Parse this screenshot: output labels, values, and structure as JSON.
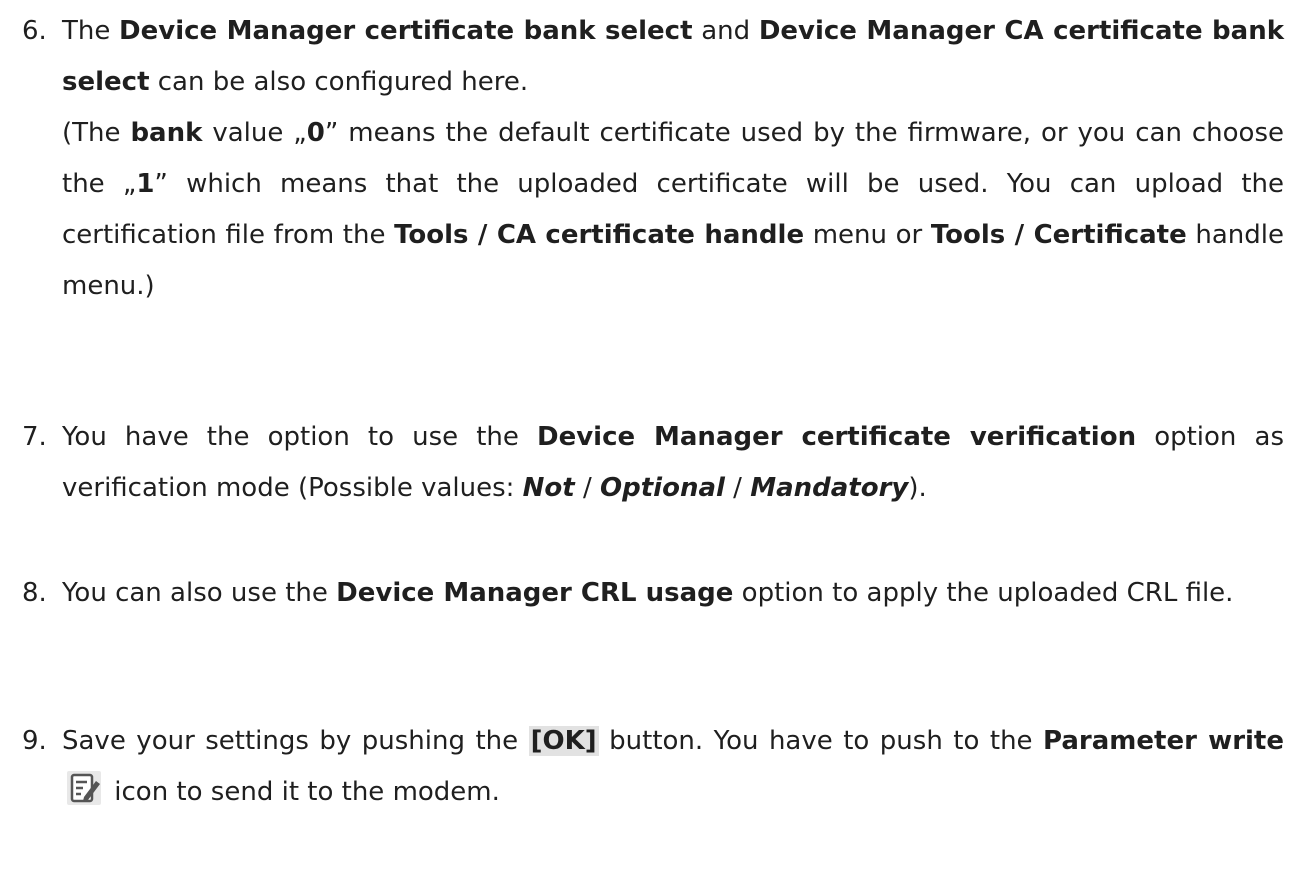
{
  "steps": [
    {
      "num": "6.",
      "line1": [
        "The ",
        "Device Manager certificate bank select",
        " and ",
        "Device Manager CA certificate bank select",
        " can be also configured here."
      ],
      "line2": [
        "(The ",
        "bank",
        " value „",
        "0",
        "” means the default certificate used by the firmware, or you can choose the „",
        "1",
        "” which means that the uploaded certificate will be used. You can upload the certification file from the ",
        "Tools / CA certificate handle",
        " menu or ",
        "Tools / Certificate",
        " handle menu.)"
      ]
    },
    {
      "num": "7.",
      "parts": [
        "You have the option to use the ",
        "Device Manager certificate verification",
        " option as verification mode (Possible values: ",
        "Not",
        " / ",
        "Optional",
        " / ",
        "Mandatory",
        ")."
      ]
    },
    {
      "num": "8.",
      "parts": [
        "You can also use the ",
        "Device Manager CRL usage",
        " option to apply the uploaded CRL file."
      ]
    },
    {
      "num": "9.",
      "parts": [
        "Save your settings by pushing the ",
        "[OK]",
        " button. You have to push to the ",
        "Parameter write",
        " icon to send it to the modem."
      ],
      "icon": "edit-document-icon"
    }
  ]
}
